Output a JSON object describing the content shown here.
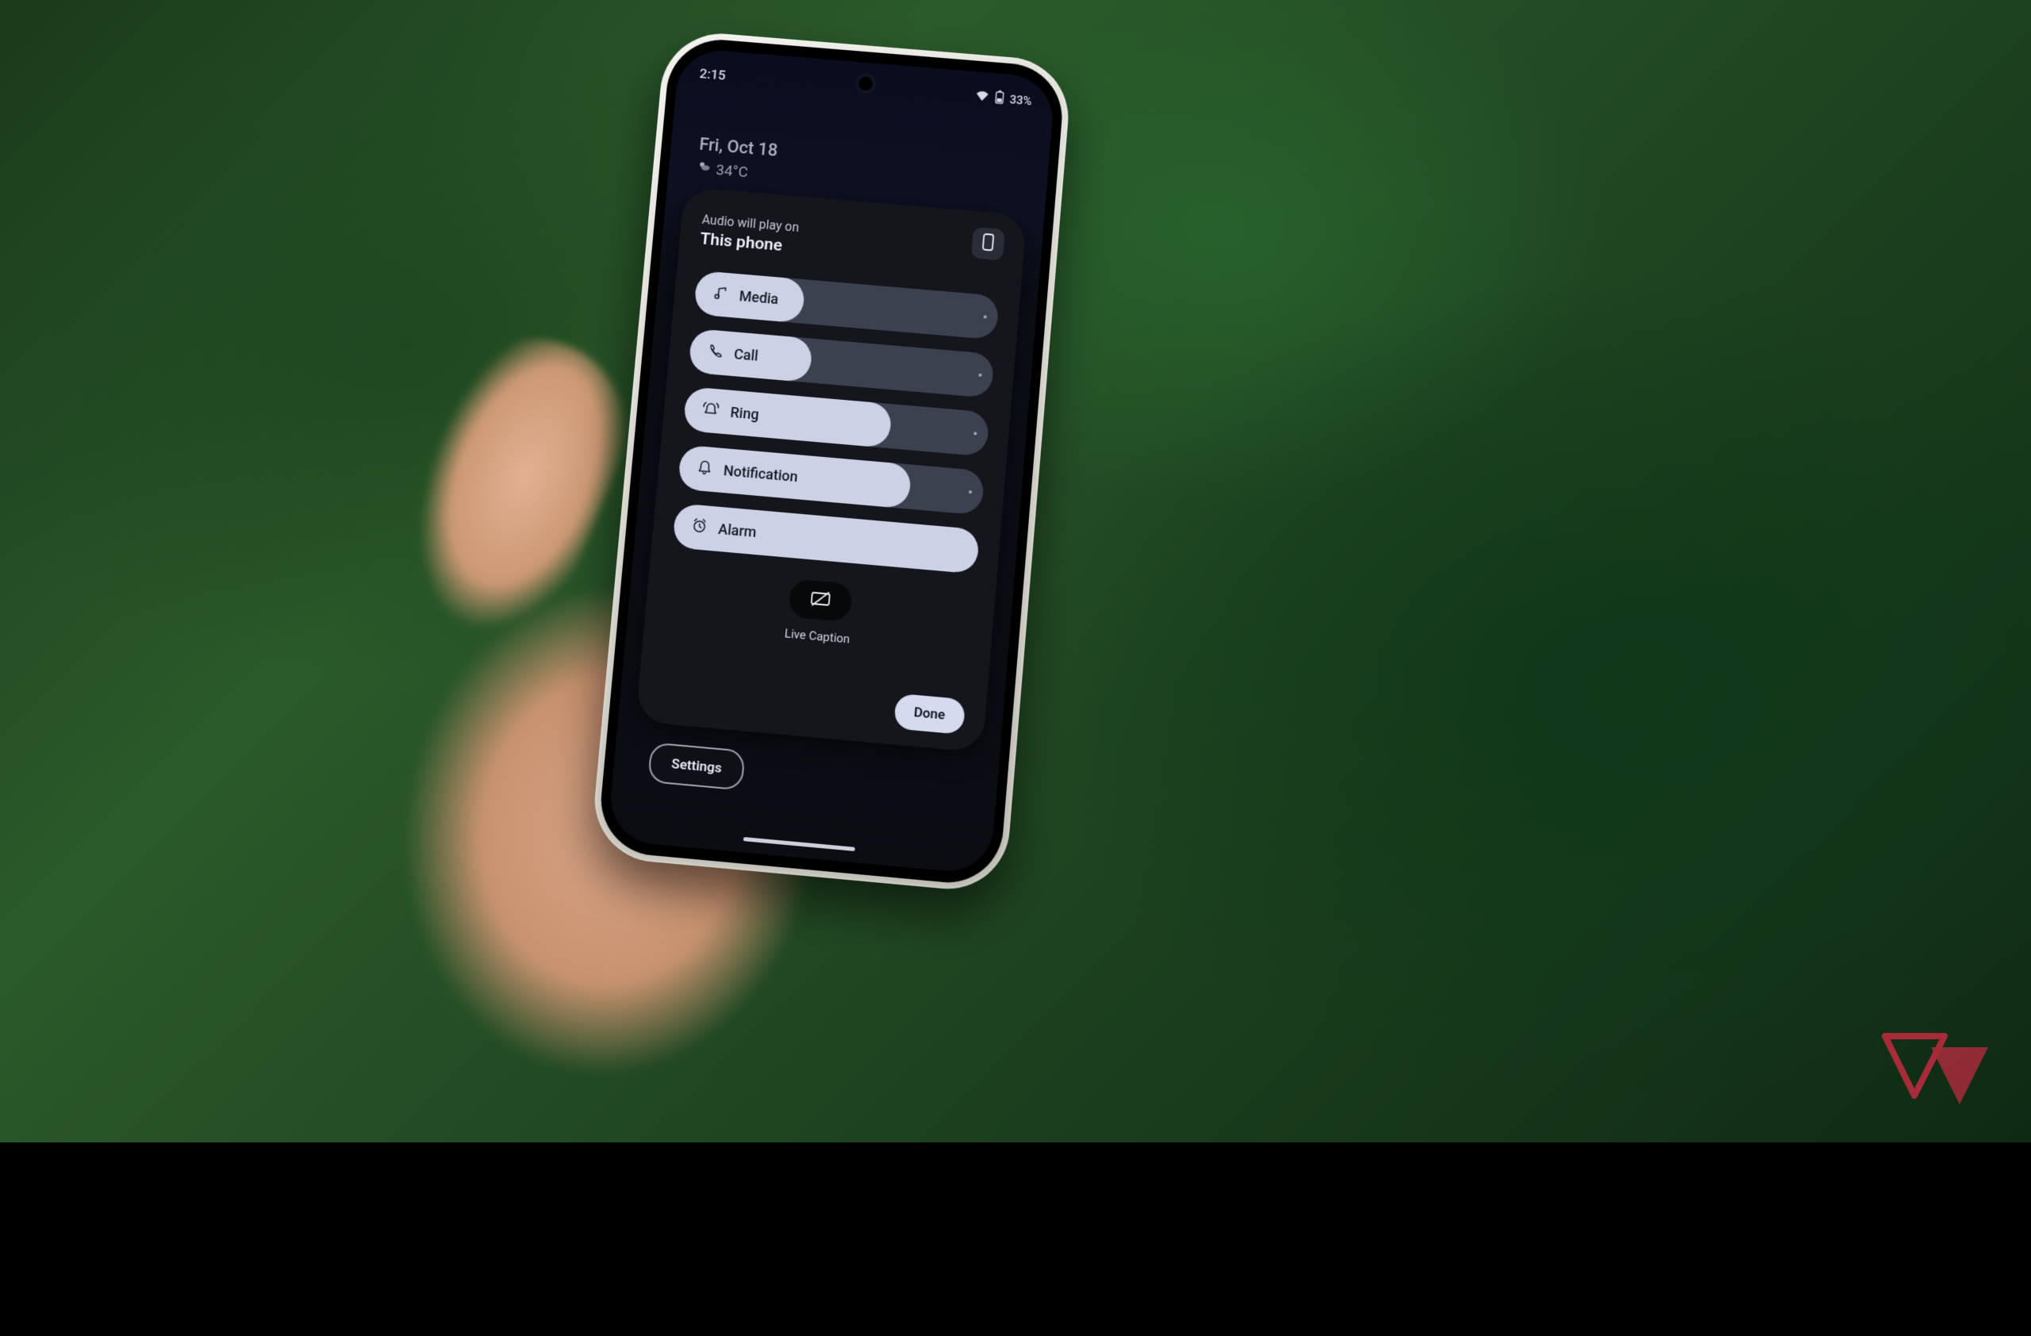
{
  "status": {
    "time": "2:15",
    "battery_text": "33%"
  },
  "home": {
    "date": "Fri, Oct 18",
    "temp": "34°C"
  },
  "panel": {
    "pre": "Audio will play on",
    "device": "This phone"
  },
  "sliders": [
    {
      "key": "media",
      "label": "Media",
      "icon": "music-note-icon",
      "fill_pct": 36
    },
    {
      "key": "call",
      "label": "Call",
      "icon": "phone-icon",
      "fill_pct": 40
    },
    {
      "key": "ring",
      "label": "Ring",
      "icon": "ring-icon",
      "fill_pct": 68
    },
    {
      "key": "notification",
      "label": "Notification",
      "icon": "bell-icon",
      "fill_pct": 76
    },
    {
      "key": "alarm",
      "label": "Alarm",
      "icon": "alarm-icon",
      "fill_pct": 100
    }
  ],
  "live_caption": {
    "label": "Live Caption"
  },
  "buttons": {
    "done": "Done",
    "settings": "Settings"
  },
  "watermark": {
    "name": "site-logo"
  }
}
